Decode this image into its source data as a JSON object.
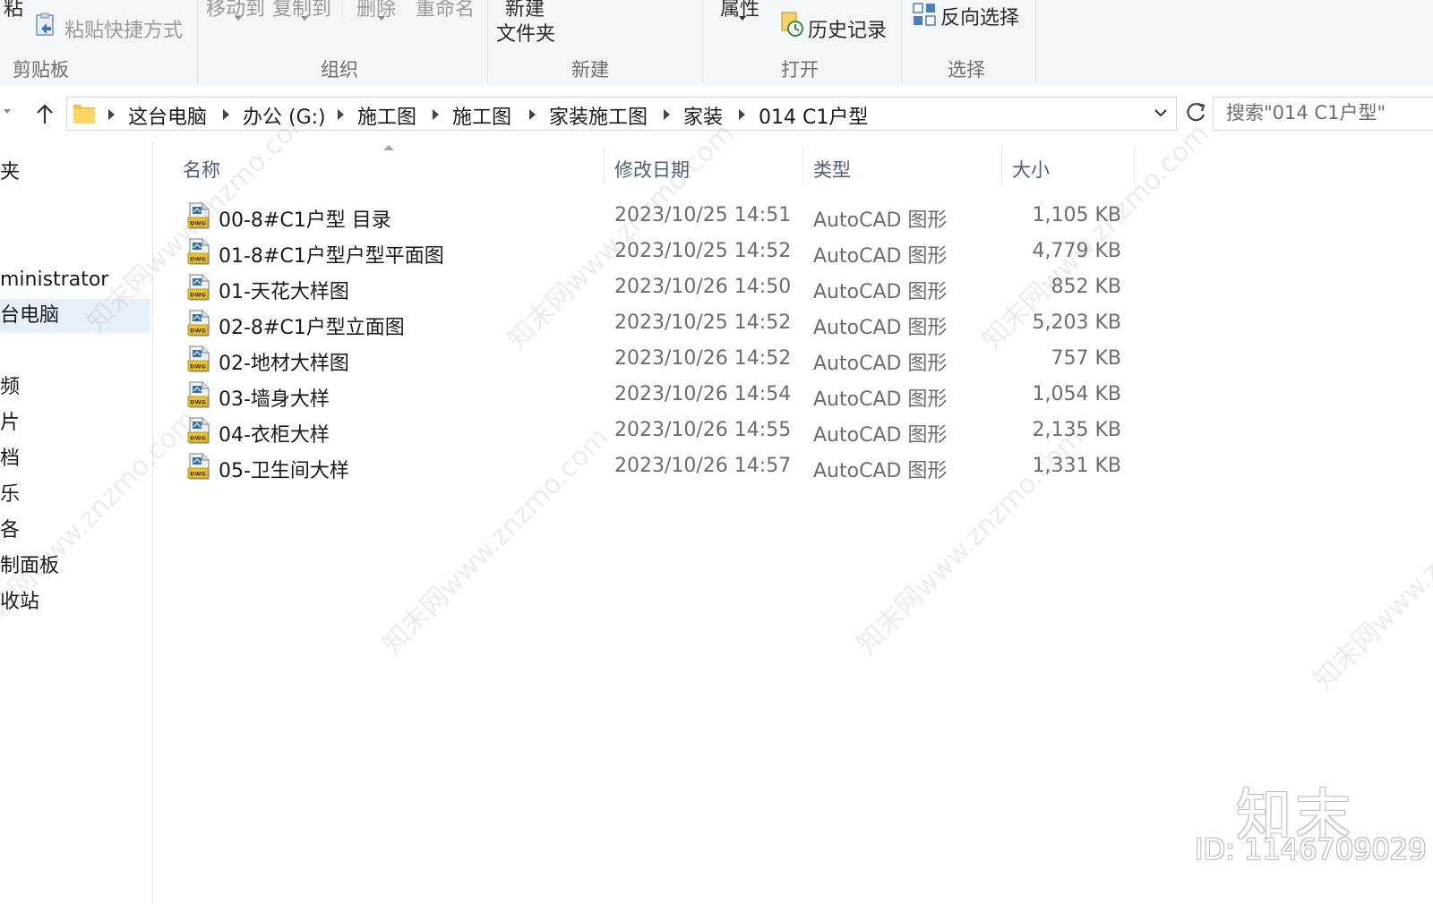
{
  "ribbon": {
    "clipboard": {
      "paste_partial": "粘",
      "paste_shortcut": "粘贴快捷方式",
      "group_label": "剪贴板"
    },
    "organize": {
      "move_to": "移动到",
      "copy_to": "复制到",
      "delete": "删除",
      "rename": "重命名",
      "group_label": "组织"
    },
    "new": {
      "new_folder_line1": "新建",
      "new_folder_line2": "文件夹",
      "group_label": "新建"
    },
    "open": {
      "properties": "属性",
      "history": "历史记录",
      "group_label": "打开"
    },
    "select": {
      "invert_selection": "反向选择",
      "group_label": "选择"
    }
  },
  "address": {
    "crumbs": [
      "这台电脑",
      "办公 (G:)",
      "施工图",
      "施工图",
      "家装施工图",
      "家装",
      "014 C1户型"
    ]
  },
  "search": {
    "placeholder": "搜索\"014 C1户型\""
  },
  "navpane": {
    "items": [
      "夹",
      "ministrator",
      "台电脑",
      "频",
      "片",
      "档",
      "乐",
      "各",
      "制面板",
      "收站"
    ]
  },
  "columns": {
    "name": "名称",
    "date": "修改日期",
    "type": "类型",
    "size": "大小"
  },
  "files": [
    {
      "name": "00-8#C1户型 目录",
      "date": "2023/10/25 14:51",
      "type": "AutoCAD 图形",
      "size": "1,105 KB"
    },
    {
      "name": "01-8#C1户型户型平面图",
      "date": "2023/10/25 14:52",
      "type": "AutoCAD 图形",
      "size": "4,779 KB"
    },
    {
      "name": "01-天花大样图",
      "date": "2023/10/26 14:50",
      "type": "AutoCAD 图形",
      "size": "852 KB"
    },
    {
      "name": "02-8#C1户型立面图",
      "date": "2023/10/25 14:52",
      "type": "AutoCAD 图形",
      "size": "5,203 KB"
    },
    {
      "name": "02-地材大样图",
      "date": "2023/10/26 14:52",
      "type": "AutoCAD 图形",
      "size": "757 KB"
    },
    {
      "name": "03-墙身大样",
      "date": "2023/10/26 14:54",
      "type": "AutoCAD 图形",
      "size": "1,054 KB"
    },
    {
      "name": "04-衣柜大样",
      "date": "2023/10/26 14:55",
      "type": "AutoCAD 图形",
      "size": "2,135 KB"
    },
    {
      "name": "05-卫生间大样",
      "date": "2023/10/26 14:57",
      "type": "AutoCAD 图形",
      "size": "1,331 KB"
    }
  ],
  "icons": {
    "file": "dwg-file-icon",
    "folder": "folder-icon"
  },
  "watermark": {
    "text": "知末网www.znzmo.com",
    "logo": "知末",
    "id": "ID: 1146709029"
  }
}
